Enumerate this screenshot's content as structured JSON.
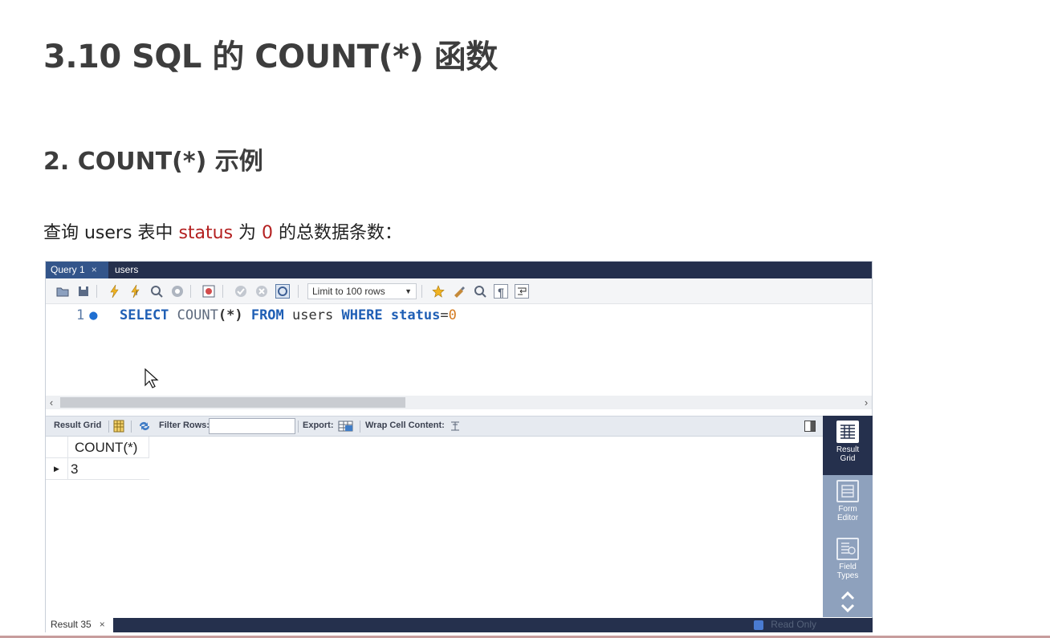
{
  "slide": {
    "title": "3.10 SQL 的 COUNT(*) 函数",
    "subtitle": "2. COUNT(*) 示例",
    "desc_prefix": "查询 users 表中 ",
    "desc_status": "status",
    "desc_mid": " 为 ",
    "desc_zero": "0",
    "desc_suffix": " 的总数据条数："
  },
  "workbench": {
    "tabs": [
      {
        "label": "Query 1",
        "close": "×"
      },
      {
        "label": "users"
      }
    ],
    "toolbar": {
      "limit_label": "Limit to 100 rows",
      "icons": [
        "folder-icon",
        "save-icon",
        "execute-icon",
        "execute-current-icon",
        "explain-icon",
        "stop-icon",
        "toggle-error-icon",
        "commit-icon",
        "rollback-icon",
        "autocommit-icon",
        "limit-dropdown",
        "beautify-icon",
        "clear-icon",
        "find-icon",
        "invisible-chars-icon",
        "wrap-icon"
      ]
    },
    "editor": {
      "line_number": "1",
      "tokens": {
        "select": "SELECT",
        "count": "COUNT",
        "paren": "(*)",
        "from": "FROM",
        "table": "users",
        "where": "WHERE",
        "column": "status",
        "eq": "=",
        "value": "0"
      }
    },
    "result_toolbar": {
      "result_grid": "Result Grid",
      "filter_rows": "Filter Rows:",
      "export": "Export:",
      "wrap": "Wrap Cell Content:"
    },
    "grid": {
      "columns": [
        "COUNT(*)"
      ],
      "rows": [
        [
          "3"
        ]
      ]
    },
    "side_panel": [
      {
        "line1": "Result",
        "line2": "Grid"
      },
      {
        "line1": "Form",
        "line2": "Editor"
      },
      {
        "line1": "Field",
        "line2": "Types"
      }
    ],
    "status": {
      "result_tab": "Result 35",
      "result_close": "×",
      "read_only": "Read Only"
    }
  }
}
